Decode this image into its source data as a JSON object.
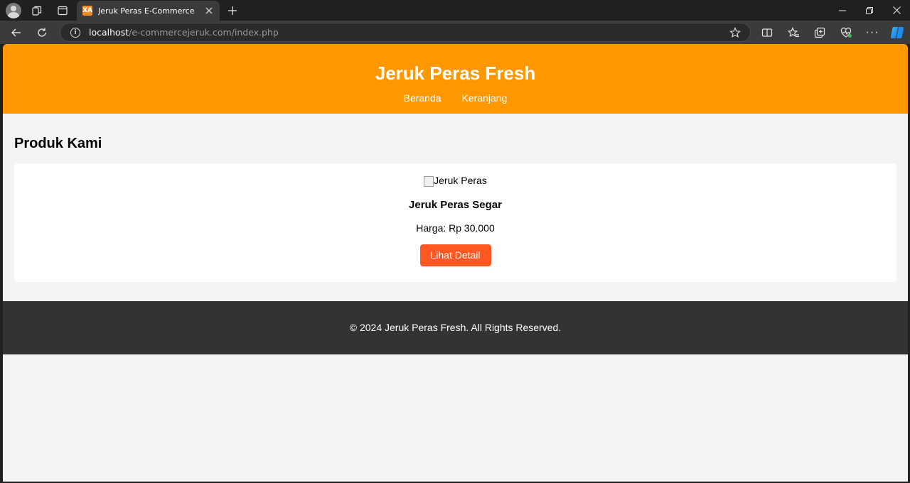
{
  "browser": {
    "tab_title": "Jeruk Peras E-Commerce",
    "favicon_label": "XA",
    "url_host": "localhost",
    "url_path": "/e-commercejeruk.com/index.php",
    "more_label": "···"
  },
  "site": {
    "title": "Jeruk Peras Fresh",
    "nav": [
      {
        "label": "Beranda"
      },
      {
        "label": "Keranjang"
      }
    ]
  },
  "main": {
    "section_title": "Produk Kami",
    "products": [
      {
        "image_alt": "Jeruk Peras",
        "name": "Jeruk Peras Segar",
        "price": "Harga: Rp 30.000",
        "button_label": "Lihat Detail"
      }
    ]
  },
  "footer": {
    "text": "© 2024 Jeruk Peras Fresh. All Rights Reserved."
  },
  "colors": {
    "header": "#ff9800",
    "button": "#ff5722",
    "footer": "#333333",
    "page_bg": "#f4f4f4"
  }
}
